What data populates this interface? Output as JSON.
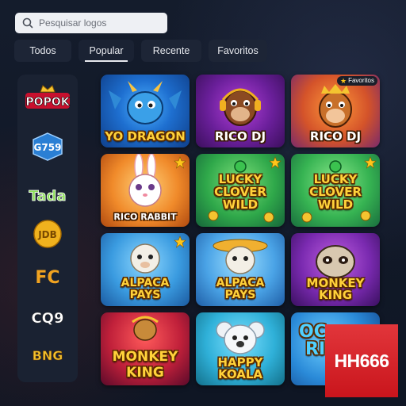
{
  "search": {
    "placeholder": "Pesquisar logos"
  },
  "tabs": [
    {
      "label": "Todos",
      "active": false
    },
    {
      "label": "Popular",
      "active": true
    },
    {
      "label": "Recente",
      "active": false
    },
    {
      "label": "Favoritos",
      "active": false
    }
  ],
  "providers": [
    {
      "label": "POPOK",
      "icon": "crown-icon"
    },
    {
      "label": "G759"
    },
    {
      "label": "Tada"
    },
    {
      "label": "JDB"
    },
    {
      "label": "FC"
    },
    {
      "label": "CQ9"
    },
    {
      "label": "BNG"
    }
  ],
  "games": [
    {
      "title": "YO DRAGON"
    },
    {
      "title": "RICO DJ"
    },
    {
      "title": "RICO DJ",
      "badge": "Favoritos"
    },
    {
      "title": "RICO RABBIT"
    },
    {
      "title_line1": "LUCKY",
      "title_line2": "CLOVER",
      "title_line3": "WILD"
    },
    {
      "title_line1": "LUCKY",
      "title_line2": "CLOVER",
      "title_line3": "WILD"
    },
    {
      "title_line1": "ALPACA",
      "title_line2": "PAYS"
    },
    {
      "title_line1": "ALPACA",
      "title_line2": "PAYS"
    },
    {
      "title": "MONKEY KING"
    },
    {
      "title_line1": "MONKEY",
      "title_line2": "KING"
    },
    {
      "title": "HAPPY KOALA"
    },
    {
      "title_line1": "OC",
      "title_line2": "RI"
    }
  ],
  "watermark": {
    "label": "HH666"
  },
  "colors": {
    "title_gold": "#ffd23a",
    "watermark_red": "#d8232a",
    "background": "#101726"
  }
}
